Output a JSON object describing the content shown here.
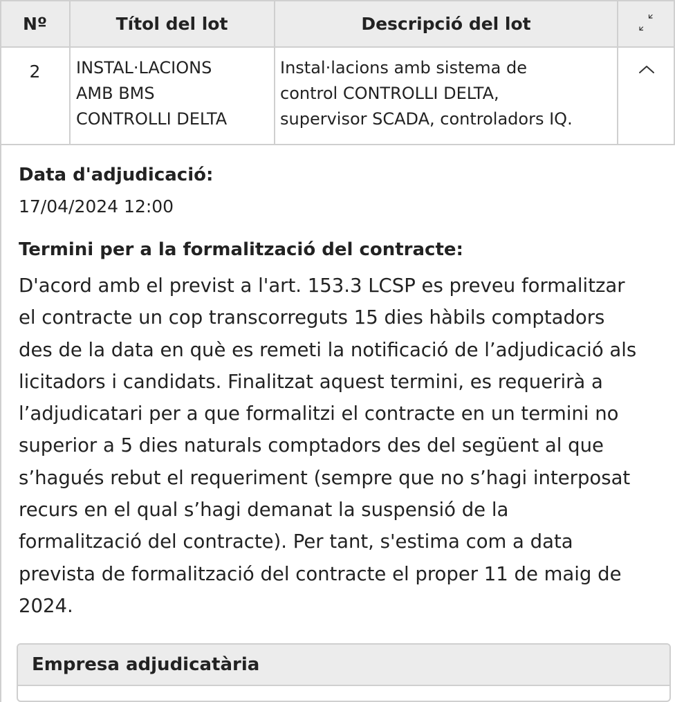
{
  "table": {
    "headers": {
      "num": "Nº",
      "title": "Títol del lot",
      "description": "Descripció del lot"
    },
    "rows": [
      {
        "num": "2",
        "title_lines": [
          "INSTAL·LACIONS",
          "AMB BMS",
          "CONTROLLI DELTA"
        ],
        "description_lines": [
          "Instal·lacions amb sistema de",
          "control CONTROLLI DELTA,",
          "supervisor SCADA, controladors IQ."
        ]
      }
    ],
    "icons": {
      "collapse_all": "collapse-arrows-icon",
      "row_toggle": "chevron-up-icon"
    }
  },
  "detail": {
    "adjudication_label": "Data d'adjudicació:",
    "adjudication_value": "17/04/2024 12:00",
    "term_label": "Termini per a la formalització del contracte:",
    "term_lines": [
      "D'acord amb el previst a l'art. 153.3 LCSP es preveu formalitzar",
      "el contracte un cop transcorreguts 15 dies hàbils comptadors",
      "des de la data en què es remeti la notificació de l’adjudicació als",
      "licitadors i candidats. Finalitzat aquest termini, es requerirà a",
      "l’adjudicatari per a que formalitzi el contracte en un termini no",
      "superior a 5 dies naturals comptadors des del següent al que",
      "s’hagués rebut el requeriment (sempre que no s’hagi interposat",
      "recurs en el qual s’hagi demanat la suspensió de la",
      "formalització del contracte). Per tant, s'estima com a data",
      "prevista de formalització del contracte el proper 11 de maig de",
      "2024."
    ],
    "company_box_title": "Empresa adjudicatària"
  },
  "colors": {
    "header_bg": "#ececec",
    "border": "#cfcfcf",
    "text": "#222222"
  }
}
